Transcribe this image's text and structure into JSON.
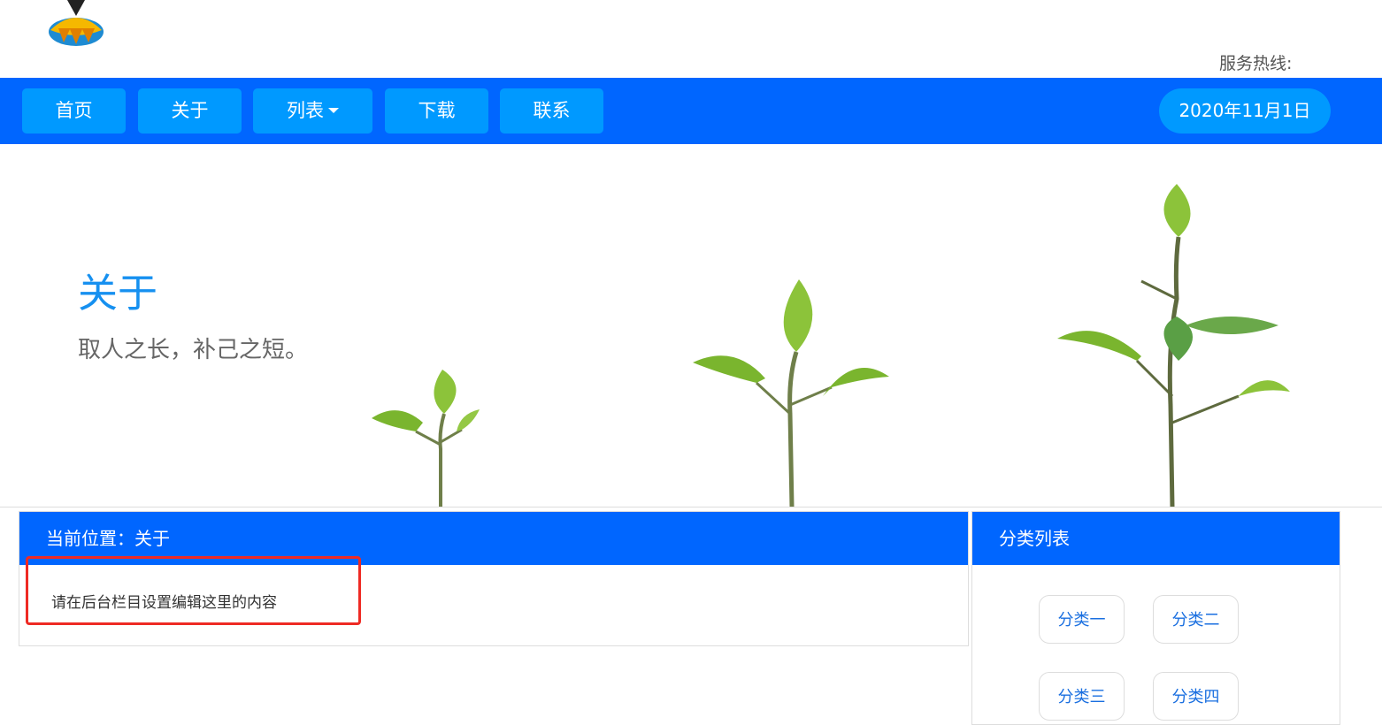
{
  "header": {
    "hotline_label": "服务热线:"
  },
  "nav": {
    "items": [
      {
        "label": "首页"
      },
      {
        "label": "关于"
      },
      {
        "label": "列表"
      },
      {
        "label": "下载"
      },
      {
        "label": "联系"
      }
    ],
    "date": "2020年11月1日"
  },
  "banner": {
    "title": "关于",
    "subtitle": "取人之长，补己之短。"
  },
  "content": {
    "breadcrumb": "当前位置：关于",
    "body_text": "请在后台栏目设置编辑这里的内容"
  },
  "sidebar": {
    "title": "分类列表",
    "categories": [
      {
        "label": "分类一"
      },
      {
        "label": "分类二"
      },
      {
        "label": "分类三"
      },
      {
        "label": "分类四"
      }
    ]
  },
  "colors": {
    "nav_bg": "#0066ff",
    "nav_button": "#0099ff",
    "banner_title": "#1690f0",
    "highlight": "#ee2a24"
  },
  "icons": {
    "logo": "pencil-logo-icon",
    "dropdown": "caret-down-icon"
  }
}
